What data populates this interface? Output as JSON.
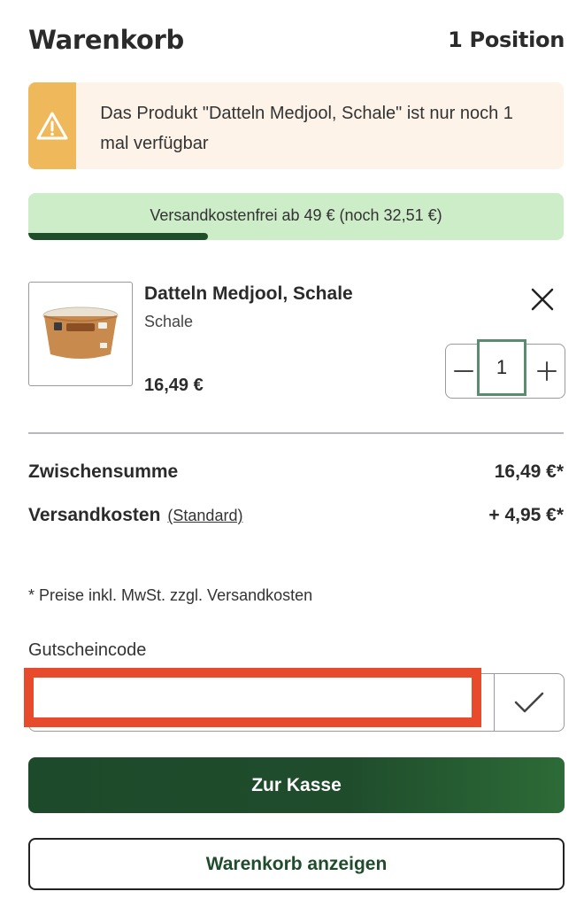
{
  "header": {
    "title": "Warenkorb",
    "count": "1 Position"
  },
  "warning": {
    "message": "Das Produkt \"Datteln Medjool, Schale\" ist nur noch 1 mal verfügbar",
    "icon": "warning-icon",
    "accent": "#efb85a"
  },
  "shipping": {
    "text": "Versandkostenfrei ab 49 € (noch 32,51 €)",
    "progress": 0.336
  },
  "product": {
    "name": "Datteln Medjool, Schale",
    "variant": "Schale",
    "price": "16,49 €",
    "quantity": "1",
    "image_icon": "product-image"
  },
  "summary": {
    "subtotal_label": "Zwischensumme",
    "subtotal_value": "16,49 €*",
    "shipping_label": "Versandkosten",
    "shipping_method": "(Standard)",
    "shipping_value": "+ 4,95 €*"
  },
  "note": "* Preise inkl. MwSt. zzgl. Versandkosten",
  "voucher": {
    "label": "Gutscheincode",
    "value": "",
    "placeholder": ""
  },
  "buttons": {
    "checkout": "Zur Kasse",
    "view_cart": "Warenkorb anzeigen"
  },
  "colors": {
    "primary": "#1f4d2c",
    "highlight": "#e84b2c",
    "shipping_bg": "#cdecc8"
  }
}
